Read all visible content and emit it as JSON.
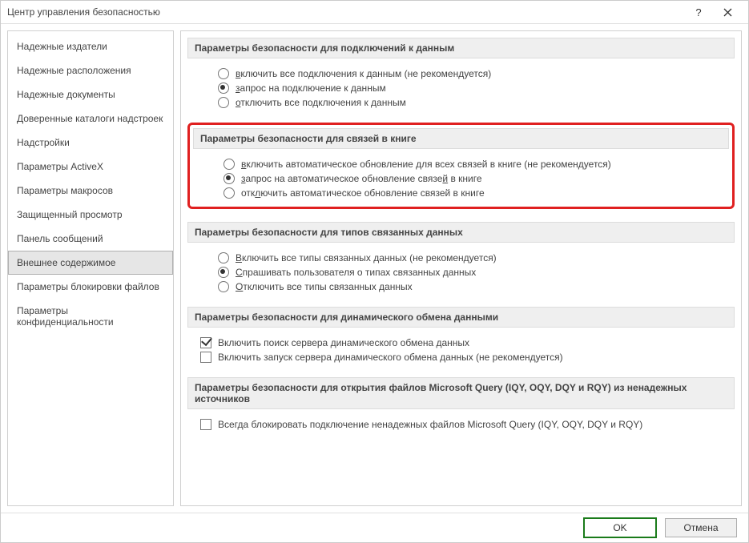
{
  "window": {
    "title": "Центр управления безопасностью"
  },
  "sidebar": {
    "items": [
      {
        "label": "Надежные издатели"
      },
      {
        "label": "Надежные расположения"
      },
      {
        "label": "Надежные документы"
      },
      {
        "label": "Доверенные каталоги надстроек"
      },
      {
        "label": "Надстройки"
      },
      {
        "label": "Параметры ActiveX"
      },
      {
        "label": "Параметры макросов"
      },
      {
        "label": "Защищенный просмотр"
      },
      {
        "label": "Панель сообщений"
      },
      {
        "label": "Внешнее содержимое",
        "selected": true
      },
      {
        "label": "Параметры блокировки файлов"
      },
      {
        "label": "Параметры конфиденциальности"
      }
    ]
  },
  "groups": {
    "dataConnections": {
      "header": "Параметры безопасности для подключений к данным",
      "options": [
        {
          "before": "",
          "u": "в",
          "after": "ключить все подключения к данным (не рекомендуется)",
          "checked": false
        },
        {
          "before": "",
          "u": "з",
          "after": "апрос на подключение к данным",
          "checked": true
        },
        {
          "before": "",
          "u": "о",
          "after": "тключить все подключения к данным",
          "checked": false
        }
      ]
    },
    "workbookLinks": {
      "header": "Параметры безопасности для связей в книге",
      "options": [
        {
          "before": "",
          "u": "в",
          "after": "ключить автоматическое обновление для всех связей в книге (не рекомендуется)",
          "checked": false
        },
        {
          "before": "",
          "u": "з",
          "after": "апрос на автоматическое обновление связе",
          "u2": "й",
          "after2": " в книге",
          "checked": true
        },
        {
          "before": "отк",
          "u": "л",
          "after": "ючить автоматическое обновление связей в книге",
          "checked": false
        }
      ]
    },
    "linkedDataTypes": {
      "header": "Параметры безопасности для типов связанных данных",
      "options": [
        {
          "before": "",
          "u": "В",
          "after": "ключить все типы связанных данных (не рекомендуется)",
          "checked": false
        },
        {
          "before": "",
          "u": "С",
          "after": "прашивать пользователя о типах связанных данных",
          "checked": true
        },
        {
          "before": "",
          "u": "О",
          "after": "тключить все типы связанных данных",
          "checked": false
        }
      ]
    },
    "dde": {
      "header": "Параметры безопасности для динамического обмена данными",
      "checks": [
        {
          "before": "Включить поиск сервера ",
          "u": "д",
          "after": "инамического обмена данных",
          "checked": true
        },
        {
          "before": "Включить запуск сервера ",
          "u": "д",
          "after": "инамического обмена данных (не рекомендуется)",
          "checked": false
        }
      ]
    },
    "msquery": {
      "header": "Параметры безопасности для открытия файлов Microsoft Query (IQY, OQY, DQY и RQY) из ненадежных источников",
      "checks": [
        {
          "before": "Всегда блокировать подключение ненадежных файлов Microsoft Query (IQY, OQY, DQY и RQY)",
          "u": "",
          "after": "",
          "checked": false
        }
      ]
    }
  },
  "footer": {
    "ok": "OK",
    "cancel": "Отмена"
  }
}
